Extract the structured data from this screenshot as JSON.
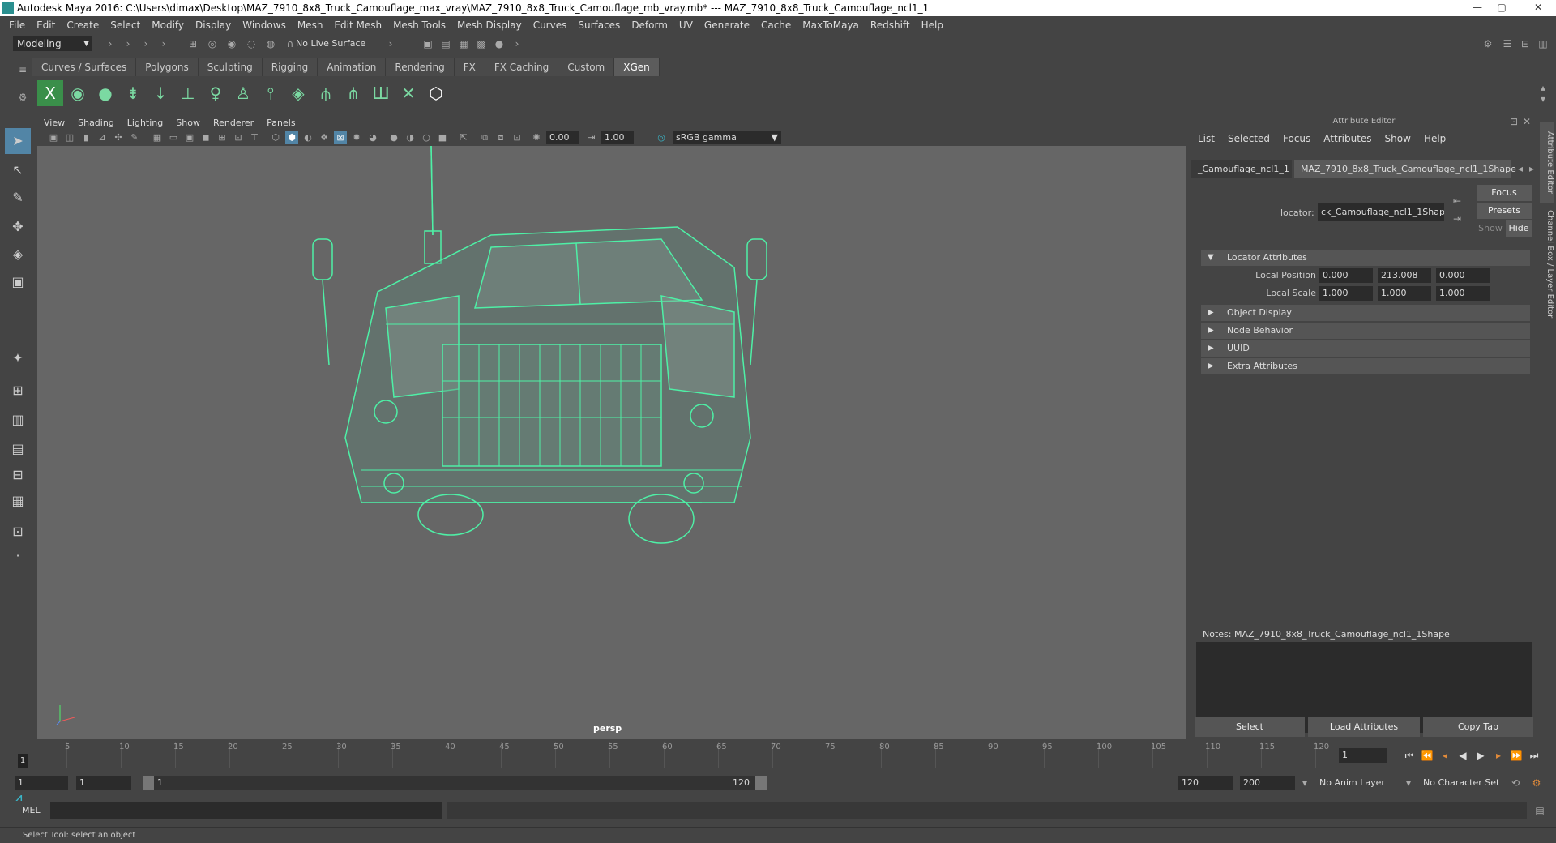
{
  "window": {
    "title": "Autodesk Maya 2016: C:\\Users\\dimax\\Desktop\\MAZ_7910_8x8_Truck_Camouflage_max_vray\\MAZ_7910_8x8_Truck_Camouflage_mb_vray.mb*   ---   MAZ_7910_8x8_Truck_Camouflage_ncl1_1",
    "minimize": "—",
    "maximize": "▢",
    "close": "✕"
  },
  "menubar": [
    "File",
    "Edit",
    "Create",
    "Select",
    "Modify",
    "Display",
    "Windows",
    "Mesh",
    "Edit Mesh",
    "Mesh Tools",
    "Mesh Display",
    "Curves",
    "Surfaces",
    "Deform",
    "UV",
    "Generate",
    "Cache",
    "MaxToMaya",
    "Redshift",
    "Help"
  ],
  "statusline": {
    "mode": "Modeling",
    "live_surface": "No Live Surface"
  },
  "shelf": {
    "tabs": [
      "Curves / Surfaces",
      "Polygons",
      "Sculpting",
      "Rigging",
      "Animation",
      "Rendering",
      "FX",
      "FX Caching",
      "Custom",
      "XGen"
    ],
    "active_tab": "XGen"
  },
  "viewport": {
    "menus": [
      "View",
      "Shading",
      "Lighting",
      "Show",
      "Renderer",
      "Panels"
    ],
    "exposure": "0.00",
    "gamma": "1.00",
    "color_space": "sRGB gamma",
    "camera_label": "persp",
    "wireframe_color": "#4ef0a6"
  },
  "attribute_editor": {
    "header": "Attribute Editor",
    "menus": [
      "List",
      "Selected",
      "Focus",
      "Attributes",
      "Show",
      "Help"
    ],
    "tab_transform": "_Camouflage_ncl1_1",
    "tab_shape": "MAZ_7910_8x8_Truck_Camouflage_ncl1_1Shape",
    "locator_label": "locator:",
    "locator_value": "ck_Camouflage_ncl1_1Shape",
    "focus_btn": "Focus",
    "presets_btn": "Presets",
    "show_btn": "Show",
    "hide_btn": "Hide",
    "sections": {
      "locator_attributes": "Locator Attributes",
      "object_display": "Object Display",
      "node_behavior": "Node Behavior",
      "uuid": "UUID",
      "extra_attributes": "Extra Attributes"
    },
    "local_position": {
      "label": "Local Position",
      "x": "0.000",
      "y": "213.008",
      "z": "0.000"
    },
    "local_scale": {
      "label": "Local Scale",
      "x": "1.000",
      "y": "1.000",
      "z": "1.000"
    },
    "notes": "Notes:  MAZ_7910_8x8_Truck_Camouflage_ncl1_1Shape",
    "select_btn": "Select",
    "load_btn": "Load Attributes",
    "copy_btn": "Copy Tab"
  },
  "side_tabs": [
    "Attribute Editor",
    "Channel Box / Layer Editor"
  ],
  "timeline": {
    "ticks": [
      "5",
      "10",
      "15",
      "20",
      "25",
      "30",
      "35",
      "40",
      "45",
      "50",
      "55",
      "60",
      "65",
      "70",
      "75",
      "80",
      "85",
      "90",
      "95",
      "100",
      "105",
      "110",
      "115",
      "120"
    ],
    "current_frame": "1",
    "current_field": "1"
  },
  "range": {
    "start": "1",
    "playback_start": "1",
    "bar_start": "1",
    "bar_end": "120",
    "playback_end": "120",
    "end": "200",
    "anim_layer": "No Anim Layer",
    "character_set": "No Character Set"
  },
  "command": {
    "mel_label": "MEL"
  },
  "helpline": "Select Tool: select an object"
}
